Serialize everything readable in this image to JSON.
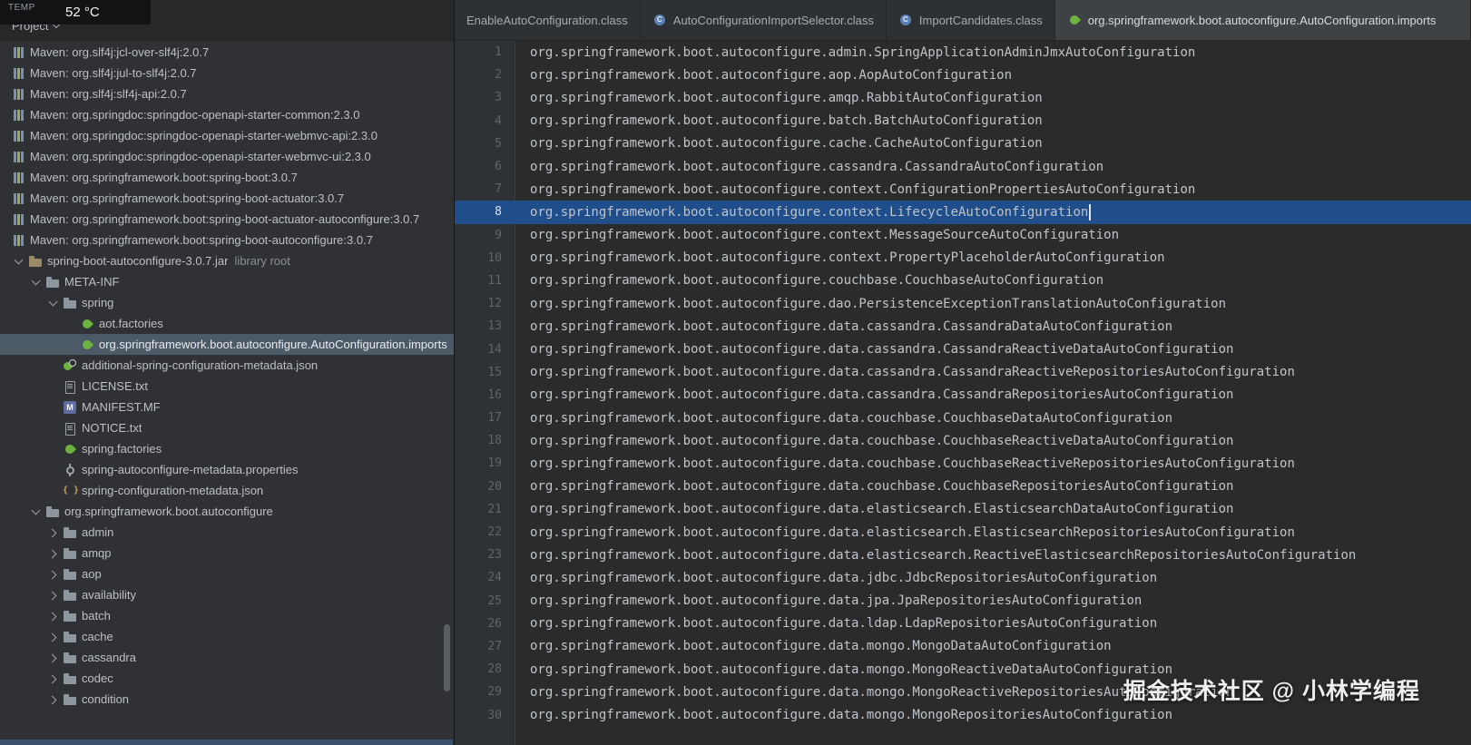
{
  "osd": {
    "label": "TEMP",
    "value": "52 °C"
  },
  "project_panel": {
    "title": "Project",
    "tree": [
      {
        "label": "Maven: org.slf4j:jcl-over-slf4j:2.0.7",
        "depth": 0,
        "icon": "maven-library",
        "chevron": null,
        "selected": false
      },
      {
        "label": "Maven: org.slf4j:jul-to-slf4j:2.0.7",
        "depth": 0,
        "icon": "maven-library",
        "chevron": null,
        "selected": false
      },
      {
        "label": "Maven: org.slf4j:slf4j-api:2.0.7",
        "depth": 0,
        "icon": "maven-library",
        "chevron": null,
        "selected": false
      },
      {
        "label": "Maven: org.springdoc:springdoc-openapi-starter-common:2.3.0",
        "depth": 0,
        "icon": "maven-library",
        "chevron": null,
        "selected": false
      },
      {
        "label": "Maven: org.springdoc:springdoc-openapi-starter-webmvc-api:2.3.0",
        "depth": 0,
        "icon": "maven-library",
        "chevron": null,
        "selected": false
      },
      {
        "label": "Maven: org.springdoc:springdoc-openapi-starter-webmvc-ui:2.3.0",
        "depth": 0,
        "icon": "maven-library",
        "chevron": null,
        "selected": false
      },
      {
        "label": "Maven: org.springframework.boot:spring-boot:3.0.7",
        "depth": 0,
        "icon": "maven-library",
        "chevron": null,
        "selected": false
      },
      {
        "label": "Maven: org.springframework.boot:spring-boot-actuator:3.0.7",
        "depth": 0,
        "icon": "maven-library",
        "chevron": null,
        "selected": false
      },
      {
        "label": "Maven: org.springframework.boot:spring-boot-actuator-autoconfigure:3.0.7",
        "depth": 0,
        "icon": "maven-library",
        "chevron": null,
        "selected": false
      },
      {
        "label": "Maven: org.springframework.boot:spring-boot-autoconfigure:3.0.7",
        "depth": 0,
        "icon": "maven-library",
        "chevron": null,
        "selected": false
      },
      {
        "label": "spring-boot-autoconfigure-3.0.7.jar",
        "suffix": "library root",
        "depth": 1,
        "icon": "jar-library",
        "chevron": "down",
        "selected": false
      },
      {
        "label": "META-INF",
        "depth": 2,
        "icon": "folder",
        "chevron": "down",
        "selected": false
      },
      {
        "label": "spring",
        "depth": 3,
        "icon": "folder",
        "chevron": "down",
        "selected": false
      },
      {
        "label": "aot.factories",
        "depth": 4,
        "icon": "spring-leaf",
        "chevron": null,
        "selected": false
      },
      {
        "label": "org.springframework.boot.autoconfigure.AutoConfiguration.imports",
        "depth": 4,
        "icon": "spring-leaf",
        "chevron": null,
        "selected": true
      },
      {
        "label": "additional-spring-configuration-metadata.json",
        "depth": 3,
        "icon": "spring-metadata",
        "chevron": null,
        "selected": false
      },
      {
        "label": "LICENSE.txt",
        "depth": 3,
        "icon": "text-file",
        "chevron": null,
        "selected": false
      },
      {
        "label": "MANIFEST.MF",
        "depth": 3,
        "icon": "manifest",
        "chevron": null,
        "selected": false
      },
      {
        "label": "NOTICE.txt",
        "depth": 3,
        "icon": "text-file",
        "chevron": null,
        "selected": false
      },
      {
        "label": "spring.factories",
        "depth": 3,
        "icon": "spring-leaf",
        "chevron": null,
        "selected": false
      },
      {
        "label": "spring-autoconfigure-metadata.properties",
        "depth": 3,
        "icon": "gear",
        "chevron": null,
        "selected": false
      },
      {
        "label": "spring-configuration-metadata.json",
        "depth": 3,
        "icon": "json",
        "chevron": null,
        "selected": false
      },
      {
        "label": "org.springframework.boot.autoconfigure",
        "depth": 2,
        "icon": "folder",
        "chevron": "down",
        "selected": false
      },
      {
        "label": "admin",
        "depth": 3,
        "icon": "folder",
        "chevron": "right",
        "selected": false
      },
      {
        "label": "amqp",
        "depth": 3,
        "icon": "folder",
        "chevron": "right",
        "selected": false
      },
      {
        "label": "aop",
        "depth": 3,
        "icon": "folder",
        "chevron": "right",
        "selected": false
      },
      {
        "label": "availability",
        "depth": 3,
        "icon": "folder",
        "chevron": "right",
        "selected": false
      },
      {
        "label": "batch",
        "depth": 3,
        "icon": "folder",
        "chevron": "right",
        "selected": false
      },
      {
        "label": "cache",
        "depth": 3,
        "icon": "folder",
        "chevron": "right",
        "selected": false
      },
      {
        "label": "cassandra",
        "depth": 3,
        "icon": "folder",
        "chevron": "right",
        "selected": false
      },
      {
        "label": "codec",
        "depth": 3,
        "icon": "folder",
        "chevron": "right",
        "selected": false
      },
      {
        "label": "condition",
        "depth": 3,
        "icon": "folder",
        "chevron": "right",
        "selected": false
      }
    ]
  },
  "tabs": [
    {
      "label": "EnableAutoConfiguration.class",
      "icon": null,
      "active": false
    },
    {
      "label": "AutoConfigurationImportSelector.class",
      "icon": "class",
      "active": false
    },
    {
      "label": "ImportCandidates.class",
      "icon": "class",
      "active": false
    },
    {
      "label": "org.springframework.boot.autoconfigure.AutoConfiguration.imports",
      "icon": "spring-leaf",
      "active": true
    }
  ],
  "editor": {
    "active_line": 8,
    "lines": [
      "org.springframework.boot.autoconfigure.admin.SpringApplicationAdminJmxAutoConfiguration",
      "org.springframework.boot.autoconfigure.aop.AopAutoConfiguration",
      "org.springframework.boot.autoconfigure.amqp.RabbitAutoConfiguration",
      "org.springframework.boot.autoconfigure.batch.BatchAutoConfiguration",
      "org.springframework.boot.autoconfigure.cache.CacheAutoConfiguration",
      "org.springframework.boot.autoconfigure.cassandra.CassandraAutoConfiguration",
      "org.springframework.boot.autoconfigure.context.ConfigurationPropertiesAutoConfiguration",
      "org.springframework.boot.autoconfigure.context.LifecycleAutoConfiguration",
      "org.springframework.boot.autoconfigure.context.MessageSourceAutoConfiguration",
      "org.springframework.boot.autoconfigure.context.PropertyPlaceholderAutoConfiguration",
      "org.springframework.boot.autoconfigure.couchbase.CouchbaseAutoConfiguration",
      "org.springframework.boot.autoconfigure.dao.PersistenceExceptionTranslationAutoConfiguration",
      "org.springframework.boot.autoconfigure.data.cassandra.CassandraDataAutoConfiguration",
      "org.springframework.boot.autoconfigure.data.cassandra.CassandraReactiveDataAutoConfiguration",
      "org.springframework.boot.autoconfigure.data.cassandra.CassandraReactiveRepositoriesAutoConfiguration",
      "org.springframework.boot.autoconfigure.data.cassandra.CassandraRepositoriesAutoConfiguration",
      "org.springframework.boot.autoconfigure.data.couchbase.CouchbaseDataAutoConfiguration",
      "org.springframework.boot.autoconfigure.data.couchbase.CouchbaseReactiveDataAutoConfiguration",
      "org.springframework.boot.autoconfigure.data.couchbase.CouchbaseReactiveRepositoriesAutoConfiguration",
      "org.springframework.boot.autoconfigure.data.couchbase.CouchbaseRepositoriesAutoConfiguration",
      "org.springframework.boot.autoconfigure.data.elasticsearch.ElasticsearchDataAutoConfiguration",
      "org.springframework.boot.autoconfigure.data.elasticsearch.ElasticsearchRepositoriesAutoConfiguration",
      "org.springframework.boot.autoconfigure.data.elasticsearch.ReactiveElasticsearchRepositoriesAutoConfiguration",
      "org.springframework.boot.autoconfigure.data.jdbc.JdbcRepositoriesAutoConfiguration",
      "org.springframework.boot.autoconfigure.data.jpa.JpaRepositoriesAutoConfiguration",
      "org.springframework.boot.autoconfigure.data.ldap.LdapRepositoriesAutoConfiguration",
      "org.springframework.boot.autoconfigure.data.mongo.MongoDataAutoConfiguration",
      "org.springframework.boot.autoconfigure.data.mongo.MongoReactiveDataAutoConfiguration",
      "org.springframework.boot.autoconfigure.data.mongo.MongoReactiveRepositoriesAutoConfiguration",
      "org.springframework.boot.autoconfigure.data.mongo.MongoRepositoriesAutoConfiguration"
    ]
  },
  "watermark": {
    "text": "掘金技术社区 @ 小林学编程"
  },
  "colors": {
    "selection_blue": "#1f4e8a",
    "tree_selection": "#4c5a68",
    "spring_green": "#6db33f",
    "class_blue": "#5a7fb5"
  }
}
